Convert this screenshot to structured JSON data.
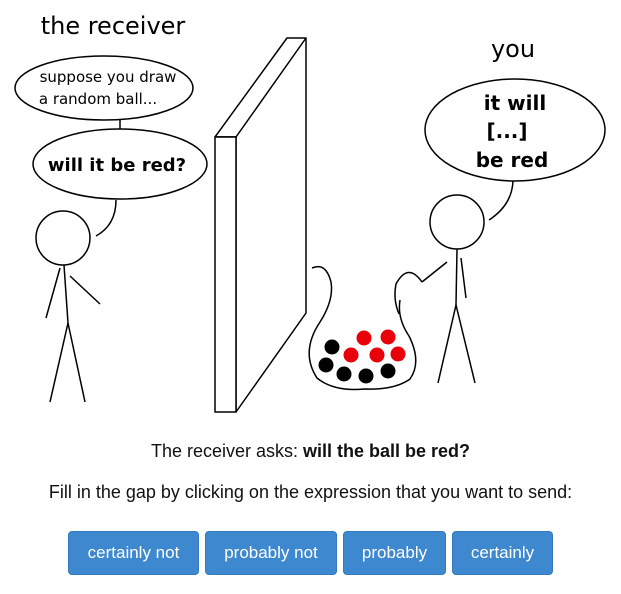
{
  "scene": {
    "receiver_label": "the receiver",
    "you_label": "you",
    "receiver_bubble_1": [
      "suppose you draw",
      "a random ball..."
    ],
    "receiver_bubble_2": "will it be red?",
    "you_bubble": [
      "it will",
      "[...]",
      "be red"
    ]
  },
  "question": {
    "prefix": "The receiver asks: ",
    "emphasis": "will the ball be red?"
  },
  "instruction": "Fill in the gap by clicking on the expression that you want to send:",
  "buttons": [
    "certainly not",
    "probably not",
    "probably",
    "certainly"
  ],
  "colors": {
    "button_bg": "#3e88cf",
    "ball_red": "#e8000b",
    "ball_black": "#000000"
  }
}
